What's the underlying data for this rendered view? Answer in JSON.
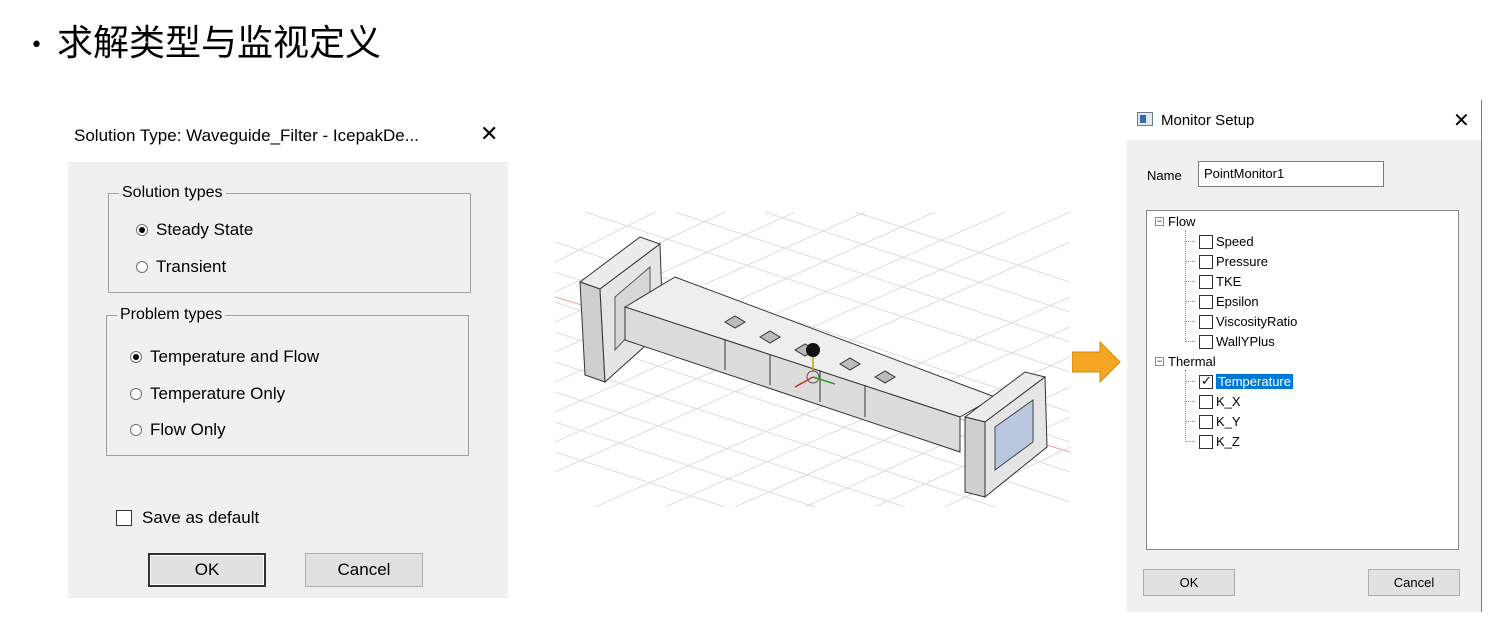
{
  "heading": {
    "bullet": "•",
    "text": "求解类型与监视定义"
  },
  "solution_dialog": {
    "title": "Solution Type: Waveguide_Filter - IcepakDe...",
    "close": "✕",
    "solution_types": {
      "legend": "Solution types",
      "options": [
        {
          "label": "Steady State",
          "selected": true
        },
        {
          "label": "Transient",
          "selected": false
        }
      ]
    },
    "problem_types": {
      "legend": "Problem types",
      "options": [
        {
          "label": "Temperature and Flow",
          "selected": true
        },
        {
          "label": "Temperature Only",
          "selected": false
        },
        {
          "label": "Flow Only",
          "selected": false
        }
      ]
    },
    "save_default": {
      "label": "Save as default",
      "checked": false
    },
    "ok": "OK",
    "cancel": "Cancel"
  },
  "model_view": {
    "icon": "waveguide-filter-3d-model"
  },
  "arrow": {
    "color": "#f5a623",
    "icon": "right-arrow-icon"
  },
  "monitor_dialog": {
    "title": "Monitor Setup",
    "close": "✕",
    "name_label": "Name",
    "name_value": "PointMonitor1",
    "tree": [
      {
        "label": "Flow",
        "expander": "−",
        "children": [
          {
            "label": "Speed",
            "checked": false
          },
          {
            "label": "Pressure",
            "checked": false
          },
          {
            "label": "TKE",
            "checked": false
          },
          {
            "label": "Epsilon",
            "checked": false
          },
          {
            "label": "ViscosityRatio",
            "checked": false
          },
          {
            "label": "WallYPlus",
            "checked": false
          }
        ]
      },
      {
        "label": "Thermal",
        "expander": "−",
        "children": [
          {
            "label": "Temperature",
            "checked": true,
            "selected": true
          },
          {
            "label": "K_X",
            "checked": false
          },
          {
            "label": "K_Y",
            "checked": false
          },
          {
            "label": "K_Z",
            "checked": false
          }
        ]
      }
    ],
    "ok": "OK",
    "cancel": "Cancel"
  }
}
